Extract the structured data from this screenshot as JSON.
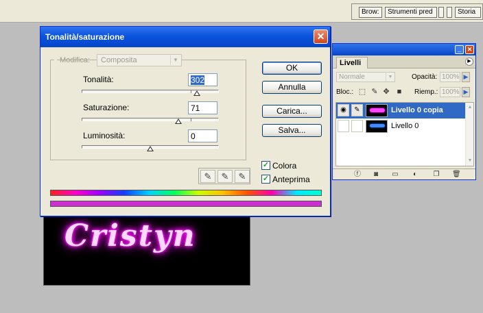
{
  "topbar": {
    "tabs": [
      "Brow:",
      "Strumenti pred",
      "",
      "",
      "Storia"
    ]
  },
  "canvas": {
    "text": "Cristyn",
    "glow_color": "#ff00ff"
  },
  "dialog": {
    "title": "Tonalità/saturazione",
    "modifica_label": "Modifica:",
    "modifica_value": "Composita",
    "fields": [
      {
        "label": "Tonalità:",
        "value": "302"
      },
      {
        "label": "Saturazione:",
        "value": "71"
      },
      {
        "label": "Luminosità:",
        "value": "0"
      }
    ],
    "buttons": {
      "ok": "OK",
      "cancel": "Annulla",
      "load": "Carica...",
      "save": "Salva..."
    },
    "checkboxes": [
      {
        "label": "Colora",
        "checked": true
      },
      {
        "label": "Anteprima",
        "checked": true
      }
    ],
    "colors": {
      "titlebar": "#0a54de",
      "colorize_bar": "#cc2fcf"
    }
  },
  "layers_panel": {
    "tab": "Livelli",
    "blend_mode": "Normale",
    "opacity_label": "Opacità:",
    "opacity_value": "100%",
    "lock_label": "Bloc.:",
    "fill_label": "Riemp.:",
    "fill_value": "100%",
    "layers": [
      {
        "name": "Livello 0 copia",
        "selected": true,
        "visible": true
      },
      {
        "name": "Livello 0",
        "selected": false,
        "visible": false
      }
    ]
  }
}
